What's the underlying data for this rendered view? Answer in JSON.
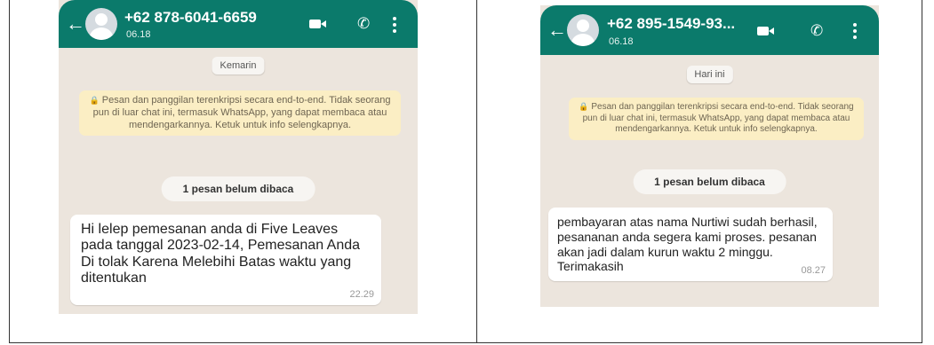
{
  "colors": {
    "header": "#0b7a6b",
    "chat_background": "#ece5dd",
    "encryption_notice": "#fbeec4",
    "bubble": "#ffffff"
  },
  "chat1": {
    "contact_number": "+62 878-6041-6659",
    "last_seen": "06.18",
    "date_chip": "Kemarin",
    "encryption_notice": "Pesan dan panggilan terenkripsi secara end-to-end. Tidak seorang pun di luar chat ini, termasuk WhatsApp, yang dapat membaca atau mendengarkannya. Ketuk untuk info selengkapnya.",
    "unread_label": "1 pesan belum dibaca",
    "message": {
      "text": "Hi lelep pemesanan anda di Five Leaves pada tanggal 2023-02-14, Pemesanan Anda Di tolak Karena Melebihi Batas waktu yang ditentukan",
      "time": "22.29"
    }
  },
  "chat2": {
    "contact_number": "+62 895-1549-93...",
    "last_seen": "06.18",
    "date_chip": "Hari ini",
    "encryption_notice": "Pesan dan panggilan terenkripsi secara end-to-end. Tidak seorang pun di luar chat ini, termasuk WhatsApp, yang dapat membaca atau mendengarkannya. Ketuk untuk info selengkapnya.",
    "unread_label": "1 pesan belum dibaca",
    "message": {
      "text": "pembayaran atas nama Nurtiwi sudah berhasil, pesananan anda segera kami proses. pesanan akan jadi dalam kurun waktu 2 minggu. Terimakasih",
      "time": "08.27"
    }
  },
  "icons": {
    "back": "arrow-left-icon",
    "video": "video-camera-icon",
    "call": "phone-icon",
    "menu": "more-vertical-icon",
    "lock": "lock-icon"
  }
}
